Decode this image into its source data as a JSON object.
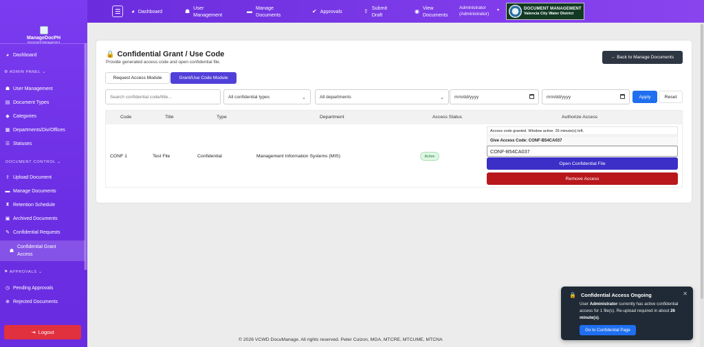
{
  "topbar": {
    "nav": [
      {
        "icon": "speedometer-icon",
        "glyph": "◕",
        "label": "Dashboard"
      },
      {
        "icon": "users-icon",
        "glyph": "☗",
        "label1": "User",
        "label2": "Management"
      },
      {
        "icon": "folder-icon",
        "glyph": "▬",
        "label1": "Manage",
        "label2": "Documents"
      },
      {
        "icon": "check-circle-icon",
        "glyph": "✔",
        "label": "Approvals"
      },
      {
        "icon": "upload-icon",
        "glyph": "⇧",
        "label1": "Submit",
        "label2": "Draft"
      },
      {
        "icon": "eye-icon",
        "glyph": "◉",
        "label1": "View",
        "label2": "Documents"
      }
    ],
    "user_line1": "Administrator",
    "user_line2": "(Administrator)",
    "brand_line1": "DOCUMENT MANAGEMENT",
    "brand_line2": "Valencia City Water District"
  },
  "sidebar": {
    "app_name": "ManageDocPH",
    "app_sub": "Document Management",
    "dashboard": "Dashboard",
    "admin_head": "ADMIN PANEL",
    "admin_items": [
      "User Management",
      "Document Types",
      "Categories",
      "Departments/Div/Offices",
      "Statuses"
    ],
    "doc_head": "DOCUMENT CONTROL",
    "doc_items": [
      "Upload Document",
      "Manage Documents",
      "Retention Schedule",
      "Archived Documents",
      "Confidential Requests"
    ],
    "active_item_line1": "Confidential Grant",
    "active_item_line2": "Access",
    "approvals_head": "APPROVALS",
    "approval_items": [
      "Pending Approvals",
      "Rejected Documents"
    ],
    "logout": "Logout"
  },
  "page": {
    "title": "Confidential Grant / Use Code",
    "subtitle": "Provide generated access code and open confidential file.",
    "back_button": "← Back to Manage Documents",
    "tabs": [
      "Request Access Module",
      "Grant/Use Code Module"
    ],
    "search_placeholder": "Search confidential code/title...",
    "type_filter": "All confidential types",
    "dept_filter": "All departments",
    "date_from": "mm/dd/yyyy",
    "date_to": "mm/dd/yyyy",
    "apply": "Apply",
    "reset": "Reset"
  },
  "table": {
    "headers": [
      "Code",
      "Title",
      "Type",
      "Department",
      "Access Status",
      "Authorize Access"
    ],
    "rows": [
      {
        "code": "CONF 1",
        "title": "Test File",
        "type": "Confidential",
        "department": "Management Information Systems (MIS)",
        "status": "Active",
        "granted_msg": "Access code granted. Window active: 26 minute(s) left.",
        "give_code": "Give Access Code: CONF-B54CA037",
        "code_value": "CONF-B54CA037",
        "open_btn": "Open Confidential File",
        "remove_btn": "Remove Access"
      }
    ]
  },
  "footer": "© 2026 VCWD DocuManage. All rights reserved. Peter Cuizon, MGA, MTCRE, MTCUME, MTCNA",
  "toast": {
    "title": "Confidential Access Ongoing",
    "body_pre": "User ",
    "body_user": "Administrator",
    "body_mid": " currently has active confidential access for 1 file(s). Re-upload required in about ",
    "body_time": "26 minute(s)",
    "body_end": ".",
    "button": "Go to Confidential Page"
  },
  "colors": {
    "accent": "#6a2cdd",
    "primary_button": "#1f6ff0",
    "danger": "#b8181c",
    "open_button": "#3b2fc7"
  }
}
